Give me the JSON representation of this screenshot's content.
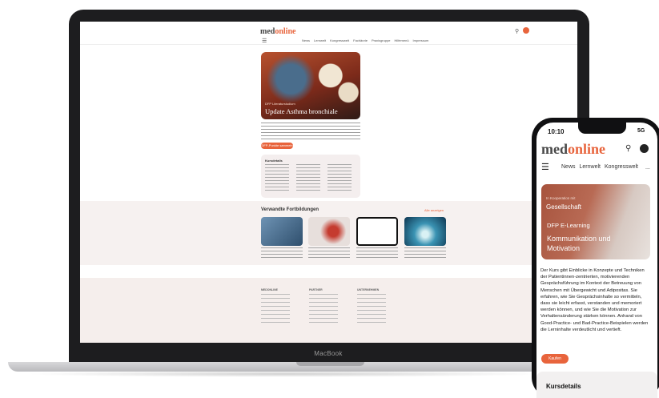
{
  "desktop": {
    "logo_main": "med",
    "logo_accent": "online",
    "nav": [
      "News",
      "Lernwelt",
      "Kongresswelt",
      "Fachärzte",
      "Praxisgruppe",
      "Hilfemenü",
      "Impressum"
    ],
    "hero": {
      "kicker": "DFP Literaturstudium",
      "title": "Update Asthma bronchiale"
    },
    "cta_label": "DFP-Punkte sammeln",
    "card_title": "Kursdetails",
    "related_title": "Verwandte Fortbildungen",
    "related_link": "Alle anzeigen",
    "footer_heads": [
      "MEDONLINE",
      "PARTNER",
      "UNTERNEHMEN"
    ],
    "brand_label": "MacBook"
  },
  "phone": {
    "time": "10:10",
    "status_right": "5G",
    "logo_main": "med",
    "logo_accent": "online",
    "nav": [
      "News",
      "Lernwelt",
      "Kongresswelt"
    ],
    "more": "...",
    "hero_kicker": "In Kooperation mit",
    "hero_brand": "Gesellschaft",
    "hero_elearning": "DFP E-Learning",
    "hero_title": "Kommunikation und Motivation",
    "description": "Der Kurs gibt Einblicke in Konzepte und Techniken der Patientinnen-zentrierten, motivierenden Gesprächsführung im Kontext der Betreuung von Menschen mit Übergewicht und Adipositas. Sie erfahren, wie Sie Gesprächsinhalte so vermitteln, dass sie leicht erfasst, verstanden und memoriert werden können, und wie Sie die Motivation zur Verhaltensänderung stärken können. Anhand von Good-Practice- und Bad-Practice-Beispielen werden die Lerninhalte verdeutlicht und vertieft.",
    "cta_label": "Kaufen",
    "details_title": "Kursdetails"
  },
  "colors": {
    "accent": "#e8643c",
    "device_frame": "#1d1d1f",
    "footer_bg": "#f5eeec"
  }
}
